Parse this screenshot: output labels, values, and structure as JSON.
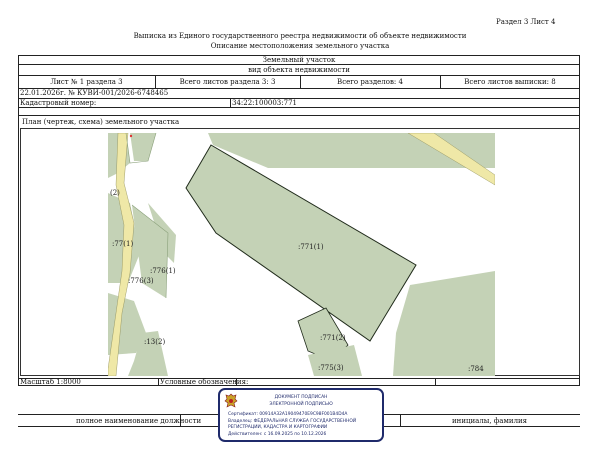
{
  "header": {
    "section_sheet": "Раздел 3   Лист 4",
    "title": "Выписка из Единого государственного реестра недвижимости об объекте недвижимости",
    "subtitle": "Описание местоположения земельного участка"
  },
  "table": {
    "object_type": "Земельный участок",
    "object_kind": "вид объекта недвижимости",
    "sheet_info": "Лист № 1 раздела 3",
    "total_sheets_section": "Всего листов раздела 3: 3",
    "total_sections": "Всего разделов: 4",
    "total_sheets_extract": "Всего листов выписки: 8",
    "date_number": "22.01.2026г. № КУВИ-001/2026-6748465",
    "cadastral_label": "Кадастровый номер:",
    "cadastral_number": "34:22:100003:771",
    "plan_label": "План (чертеж, схема) земельного участка"
  },
  "map": {
    "labels": {
      "l1": "(2)",
      "l2": ":77(1)",
      "l3": ":776(1)",
      "l4": ":776(3)",
      "l5": ":771(1)",
      "l6": ":13(2)",
      "l7": ":771(2)",
      "l8": ":775(3)",
      "l9": ":784"
    },
    "colors": {
      "parcel_fill": "#c4d2b6",
      "road_fill": "#efe8a7",
      "line": "#1f2a1a"
    }
  },
  "footer": {
    "scale": "Масштаб 1:8000",
    "legend": "Условные обозначения:",
    "position_label": "полное наименование должности",
    "name_label": "инициалы, фамилия"
  },
  "stamp": {
    "line1": "ДОКУМЕНТ ПОДПИСАН",
    "line2": "ЭЛЕКТРОННОЙ ПОДПИСЬЮ",
    "cert": "Сертификат: 00914A32A19049470E9C98F001B4D4A",
    "owner1": "Владелец: ФЕДЕРАЛЬНАЯ СЛУЖБА ГОСУДАРСТВЕННОЙ",
    "owner2": "РЕГИСТРАЦИИ, КАДАСТРА И КАРТОГРАФИИ",
    "valid": "Действителен: с 16.09.2025 по 10.12.2026"
  }
}
